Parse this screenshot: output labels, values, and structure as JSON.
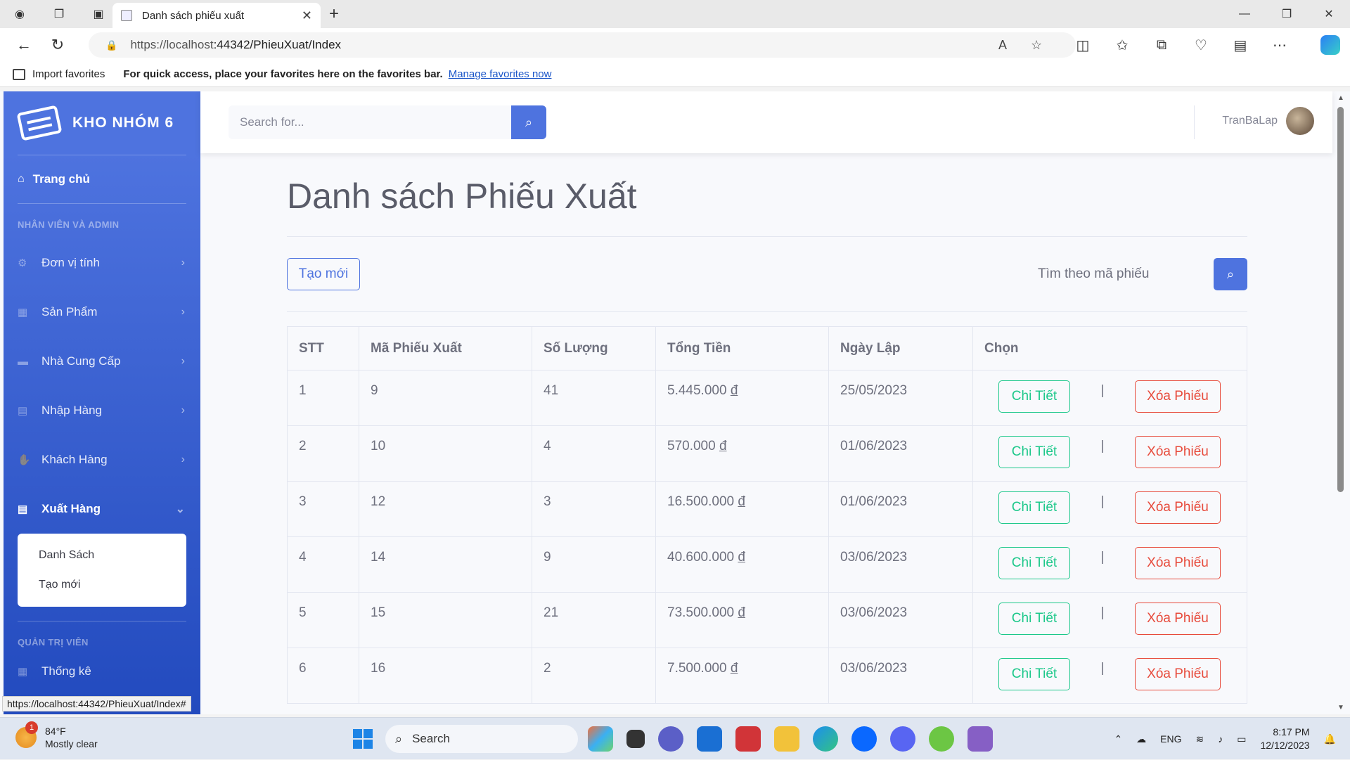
{
  "browser": {
    "tab_title": "Danh sách phiếu xuất",
    "url_host": "https://localhost",
    "url_path": ":44342/PhieuXuat/Index",
    "favbar_import": "Import favorites",
    "favbar_msg": "For quick access, place your favorites here on the favorites bar.",
    "favbar_link": "Manage favorites now",
    "status_url": "https://localhost:44342/PhieuXuat/Index#"
  },
  "sidebar": {
    "brand": "KHO NHÓM 6",
    "home": "Trang chủ",
    "section1": "NHÂN VIÊN VÀ ADMIN",
    "items": [
      {
        "label": "Đơn vị tính",
        "icon": "gear-icon"
      },
      {
        "label": "Sản Phẩm",
        "icon": "dolly-icon"
      },
      {
        "label": "Nhà Cung Cấp",
        "icon": "truck-icon"
      },
      {
        "label": "Nhập Hàng",
        "icon": "file-import-icon"
      },
      {
        "label": "Khách Hàng",
        "icon": "handshake-icon"
      },
      {
        "label": "Xuất Hàng",
        "icon": "file-export-icon"
      }
    ],
    "submenu": [
      "Danh Sách",
      "Tạo mới"
    ],
    "section2": "QUẢN TRỊ VIÊN",
    "stats": "Thống kê"
  },
  "topbar": {
    "search_placeholder": "Search for...",
    "username": "TranBaLap"
  },
  "main": {
    "title": "Danh sách Phiếu Xuất",
    "new_button": "Tạo mới",
    "find_placeholder": "Tìm theo mã phiếu",
    "columns": [
      "STT",
      "Mã Phiếu Xuất",
      "Số Lượng",
      "Tổng Tiền",
      "Ngày Lập",
      "Chọn"
    ],
    "rows": [
      {
        "stt": "1",
        "ma": "9",
        "sl": "41",
        "tien": "5.445.000",
        "ngay": "25/05/2023"
      },
      {
        "stt": "2",
        "ma": "10",
        "sl": "4",
        "tien": "570.000",
        "ngay": "01/06/2023"
      },
      {
        "stt": "3",
        "ma": "12",
        "sl": "3",
        "tien": "16.500.000",
        "ngay": "01/06/2023"
      },
      {
        "stt": "4",
        "ma": "14",
        "sl": "9",
        "tien": "40.600.000",
        "ngay": "03/06/2023"
      },
      {
        "stt": "5",
        "ma": "15",
        "sl": "21",
        "tien": "73.500.000",
        "ngay": "03/06/2023"
      },
      {
        "stt": "6",
        "ma": "16",
        "sl": "2",
        "tien": "7.500.000",
        "ngay": "03/06/2023"
      }
    ],
    "currency": "đ",
    "detail_label": "Chi Tiết",
    "separator": "|",
    "delete_label": "Xóa Phiếu"
  },
  "taskbar": {
    "temp": "84°F",
    "weather": "Mostly clear",
    "weather_badge": "1",
    "search": "Search",
    "lang": "ENG",
    "time": "8:17 PM",
    "date": "12/12/2023"
  }
}
